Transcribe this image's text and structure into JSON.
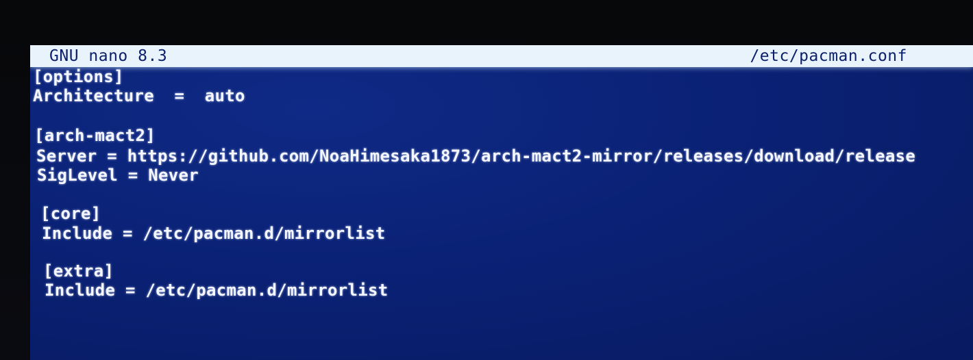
{
  "titlebar": {
    "app": "GNU nano 8.3",
    "file": "/etc/pacman.conf"
  },
  "editor": {
    "lines": [
      "[options]",
      "Architecture  =  auto",
      "",
      "[arch-mact2]",
      "Server = https://github.com/NoaHimesaka1873/arch-mact2-mirror/releases/download/release",
      "SigLevel = Never",
      "",
      "[core]",
      "Include = /etc/pacman.d/mirrorlist",
      "",
      "[extra]",
      "Include = /etc/pacman.d/mirrorlist"
    ]
  },
  "colors": {
    "background": "#0a2175",
    "text": "#f4f7ff",
    "titlebar_bg": "#e9f3fb",
    "titlebar_text": "#0b1f6b"
  }
}
